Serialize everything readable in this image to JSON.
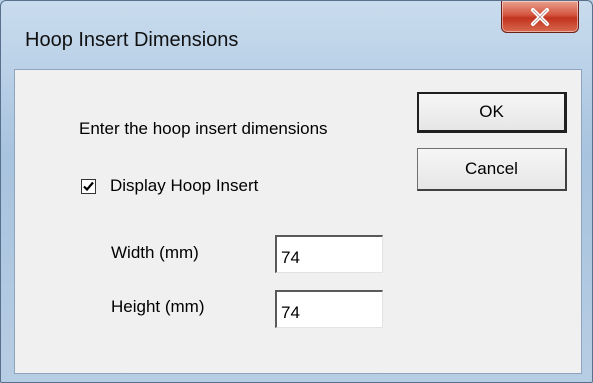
{
  "window": {
    "title": "Hoop Insert Dimensions",
    "close_icon": "close-icon"
  },
  "dialog": {
    "prompt": "Enter the hoop insert dimensions",
    "ok_label": "OK",
    "cancel_label": "Cancel",
    "display_checkbox": {
      "label": "Display Hoop Insert",
      "checked": true
    },
    "width": {
      "label": "Width (mm)",
      "value": "74"
    },
    "height": {
      "label": "Height (mm)",
      "value": "74"
    }
  }
}
